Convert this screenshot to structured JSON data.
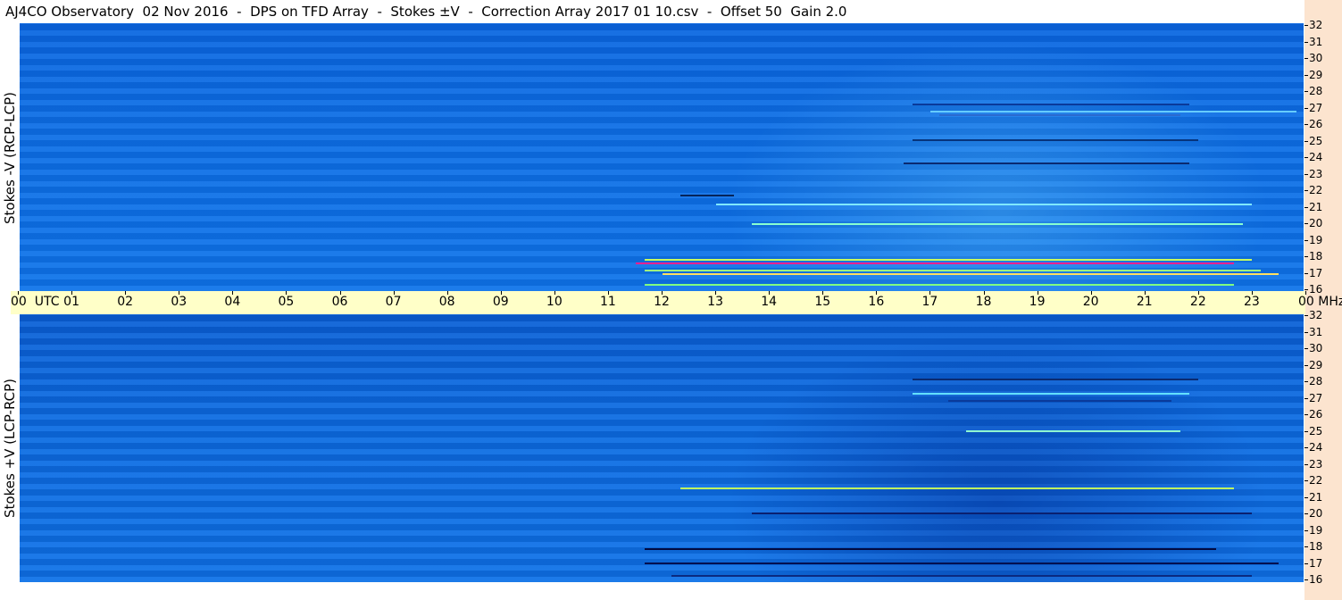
{
  "title": "AJ4CO Observatory  02 Nov 2016  -  DPS on TFD Array  -  Stokes ±V  -  Correction Array 2017 01 10.csv  -  Offset 50  Gain 2.0",
  "top_panel": {
    "label": "Stokes -V (RCP-LCP)"
  },
  "bottom_panel": {
    "label": "Stokes +V (LCP-RCP)"
  },
  "time_axis": {
    "ticks": [
      "00",
      "01",
      "02",
      "03",
      "04",
      "05",
      "06",
      "07",
      "08",
      "09",
      "10",
      "11",
      "12",
      "13",
      "14",
      "15",
      "16",
      "17",
      "18",
      "19",
      "20",
      "21",
      "22",
      "23",
      "00"
    ],
    "first_unit": "UTC",
    "last_unit": "MHz"
  },
  "freq_axis": {
    "ticks": [
      "32",
      "31",
      "30",
      "29",
      "28",
      "27",
      "26",
      "25",
      "24",
      "23",
      "22",
      "21",
      "20",
      "19",
      "18",
      "17",
      "16"
    ]
  },
  "colors": {
    "background_blue": "#0c70e8",
    "timebar_bg": "#ffffc8",
    "right_strip_bg": "#fce4cf"
  }
}
